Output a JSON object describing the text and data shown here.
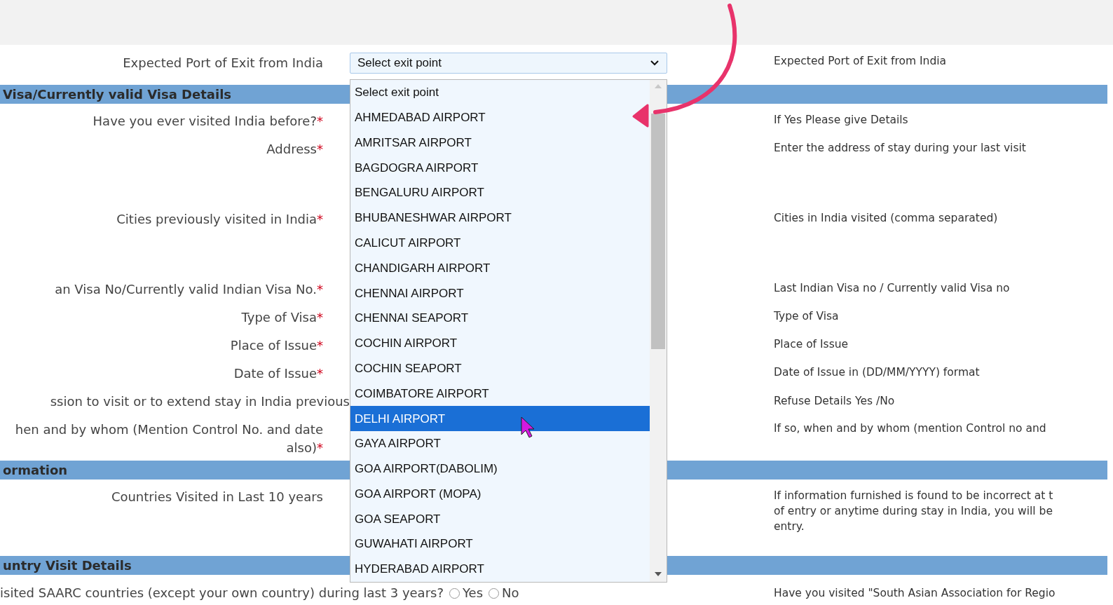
{
  "form": {
    "rows": [
      {
        "kind": "select",
        "label": "Expected Port of Exit from India",
        "value": "Select exit point",
        "help": [
          "Expected Port of Exit from India"
        ]
      },
      {
        "kind": "header",
        "title": "Visa/Currently valid Visa Details"
      },
      {
        "kind": "field",
        "label": "Have you ever visited India before?",
        "required_mark": "*",
        "help": [
          "If Yes Please give Details"
        ]
      },
      {
        "kind": "textarea",
        "label": "Address",
        "required_mark": "*",
        "help": [
          "Enter the address of stay during your last visit"
        ]
      },
      {
        "kind": "textarea",
        "label": "Cities previously visited in India",
        "required_mark": "*",
        "help": [
          "Cities in India visited (comma separated)"
        ]
      },
      {
        "kind": "field",
        "label": "an Visa No/Currently valid Indian Visa No.",
        "required_mark": "*",
        "help": [
          "Last Indian Visa no / Currently valid Visa no"
        ]
      },
      {
        "kind": "field",
        "label": "Type of Visa",
        "required_mark": "*",
        "help": [
          "Type of Visa"
        ]
      },
      {
        "kind": "field",
        "label": "Place of Issue",
        "required_mark": "*",
        "help": [
          "Place of Issue"
        ]
      },
      {
        "kind": "field",
        "label": "Date of Issue",
        "required_mark": "*",
        "help": [
          "Date of Issue in (DD/MM/YYYY) format"
        ]
      },
      {
        "kind": "wide",
        "label": "ssion to visit or to extend stay in India previous",
        "help": [
          "Refuse Details Yes /No"
        ]
      },
      {
        "kind": "tall",
        "label": "hen and by whom (Mention Control No. and date also)",
        "required_mark": "*",
        "help": [
          "If so, when and by whom (mention Control no and"
        ]
      },
      {
        "kind": "header",
        "title": "ormation"
      },
      {
        "kind": "textarea",
        "label": "Countries Visited in Last 10 years",
        "help": [
          "If information furnished is found to be incorrect at t",
          "of entry or anytime during stay in India, you will be",
          "entry."
        ]
      },
      {
        "kind": "header",
        "title": "untry Visit Details"
      },
      {
        "kind": "radio",
        "label": "isited SAARC countries (except your own country) during last 3 years?",
        "options": [
          {
            "label": "Yes",
            "selected": false
          },
          {
            "label": "No",
            "selected": false
          }
        ],
        "help": [
          "Have you visited \"South Asian Association for Regio"
        ]
      }
    ]
  },
  "dropdown": {
    "options": [
      {
        "label": "Select exit point",
        "selected": false
      },
      {
        "label": "AHMEDABAD AIRPORT",
        "selected": false
      },
      {
        "label": "AMRITSAR AIRPORT",
        "selected": false
      },
      {
        "label": "BAGDOGRA AIRPORT",
        "selected": false
      },
      {
        "label": "BENGALURU AIRPORT",
        "selected": false
      },
      {
        "label": "BHUBANESHWAR AIRPORT",
        "selected": false
      },
      {
        "label": "CALICUT AIRPORT",
        "selected": false
      },
      {
        "label": "CHANDIGARH AIRPORT",
        "selected": false
      },
      {
        "label": "CHENNAI AIRPORT",
        "selected": false
      },
      {
        "label": "CHENNAI SEAPORT",
        "selected": false
      },
      {
        "label": "COCHIN AIRPORT",
        "selected": false
      },
      {
        "label": "COCHIN SEAPORT",
        "selected": false
      },
      {
        "label": "COIMBATORE AIRPORT",
        "selected": false
      },
      {
        "label": "DELHI AIRPORT",
        "selected": true
      },
      {
        "label": "GAYA AIRPORT",
        "selected": false
      },
      {
        "label": "GOA AIRPORT(DABOLIM)",
        "selected": false
      },
      {
        "label": "GOA AIRPORT (MOPA)",
        "selected": false
      },
      {
        "label": "GOA SEAPORT",
        "selected": false
      },
      {
        "label": "GUWAHATI AIRPORT",
        "selected": false
      },
      {
        "label": "HYDERABAD AIRPORT",
        "selected": false
      }
    ]
  }
}
